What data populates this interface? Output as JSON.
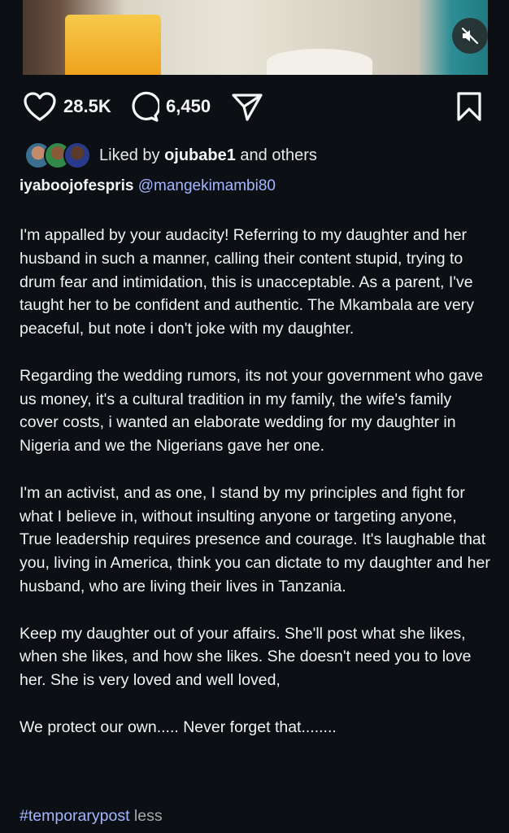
{
  "media": {
    "mute_icon": "speaker-muted-icon"
  },
  "actions": {
    "like_count": "28.5K",
    "comment_count": "6,450",
    "icons": [
      "heart-icon",
      "comment-icon",
      "share-icon",
      "bookmark-icon"
    ]
  },
  "likes": {
    "prefix": "Liked by ",
    "user": "ojubabe1",
    "suffix": " and others"
  },
  "post": {
    "author": "iyaboojofespris",
    "mention": "@mangekimambi80",
    "paragraphs": [
      "I'm appalled by your audacity! Referring to my daughter and her husband in such a manner, calling their content stupid, trying to drum fear and intimidation, this is unacceptable. As a parent, I've taught her to be confident and authentic. The Mkambala are very peaceful, but note i don't joke with my daughter.",
      "Regarding the wedding rumors, its not your government who gave us money, it's a cultural tradition in my family, the wife's family cover costs, i wanted an elaborate wedding for my daughter in Nigeria and we the Nigerians gave her one.",
      "I'm an activist, and as one, I stand by my principles and fight for what I believe in, without insulting anyone or targeting anyone, True leadership requires presence and courage. It's laughable that you, living in America, think you can dictate to my daughter and her husband, who are living their lives in Tanzania.",
      "Keep my daughter out of your affairs. She'll post what she likes, when she likes, and how she likes. She doesn't need you to love her. She is very loved and well loved,",
      "We protect our own..... Never forget that........"
    ],
    "hashtag": "#temporarypost",
    "less_label": "less"
  }
}
